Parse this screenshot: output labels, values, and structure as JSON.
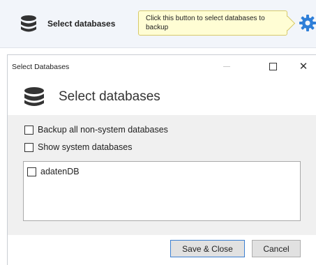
{
  "toolbar": {
    "select_button_label": "Select databases",
    "tooltip_text": "Click this button to select databases to backup",
    "icons": {
      "database": "database-icon",
      "settings": "gear-icon"
    },
    "colors": {
      "gear": "#2f7fd8",
      "tooltip_bg": "#fffdd4"
    }
  },
  "dialog": {
    "window_title": "Select Databases",
    "window_controls": {
      "minimize": "—",
      "maximize": "☐",
      "close": "✕"
    },
    "header_title": "Select databases",
    "options": {
      "backup_all_label": "Backup all non-system databases",
      "backup_all_checked": false,
      "show_system_label": "Show system databases",
      "show_system_checked": false
    },
    "databases": [
      {
        "name": "adatenDB",
        "checked": false
      }
    ],
    "buttons": {
      "save_close": "Save & Close",
      "cancel": "Cancel"
    }
  }
}
